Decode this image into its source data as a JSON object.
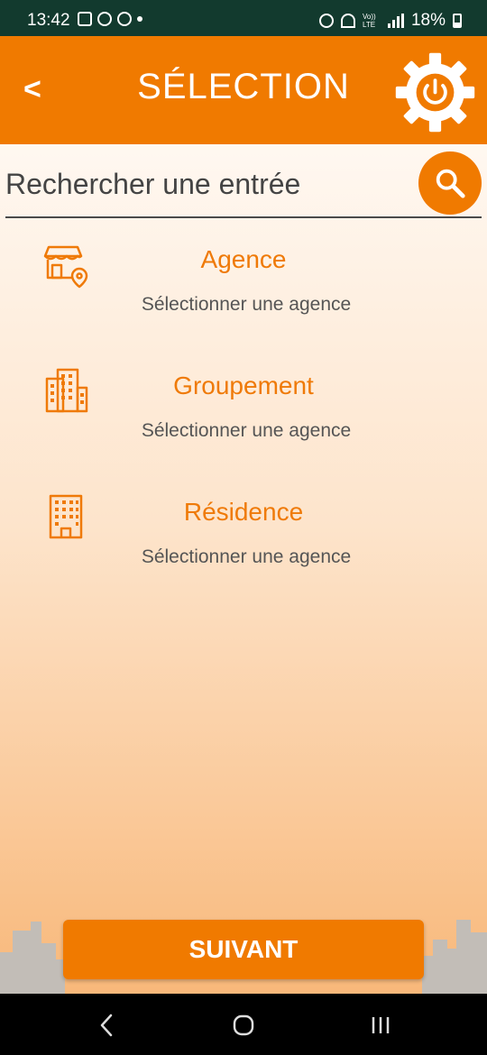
{
  "status_bar": {
    "time": "13:42",
    "battery": "18%",
    "net_label": "Vo)) LTE"
  },
  "header": {
    "back_label": "<",
    "title": "SÉLECTION",
    "settings_icon": "gear-power-icon"
  },
  "search": {
    "placeholder": "Rechercher une entrée",
    "value": "",
    "icon": "search-icon"
  },
  "items": [
    {
      "title": "Agence",
      "subtitle": "Sélectionner une agence",
      "icon": "store-location-icon"
    },
    {
      "title": "Groupement",
      "subtitle": "Sélectionner une agence",
      "icon": "buildings-icon"
    },
    {
      "title": "Résidence",
      "subtitle": "Sélectionner une agence",
      "icon": "building-icon"
    }
  ],
  "footer": {
    "next_label": "SUIVANT"
  },
  "colors": {
    "accent": "#f07a00",
    "status_bar": "#123a2e",
    "item_text": "#ef7a08"
  }
}
